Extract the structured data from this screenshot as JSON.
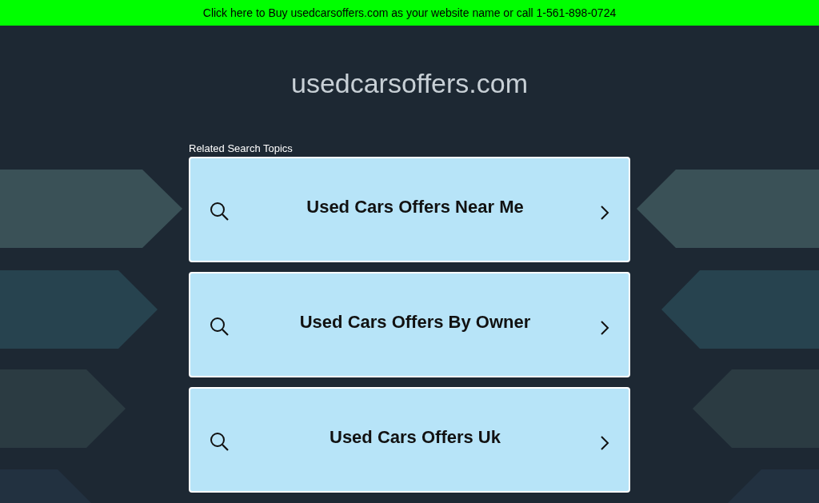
{
  "banner": {
    "text": "Click here to Buy usedcarsoffers.com as your website name or call 1-561-898-0724"
  },
  "site_title": "usedcarsoffers.com",
  "related_heading": "Related Search Topics",
  "topics": [
    {
      "label": "Used Cars Offers Near Me"
    },
    {
      "label": "Used Cars Offers By Owner"
    },
    {
      "label": "Used Cars Offers Uk"
    }
  ]
}
